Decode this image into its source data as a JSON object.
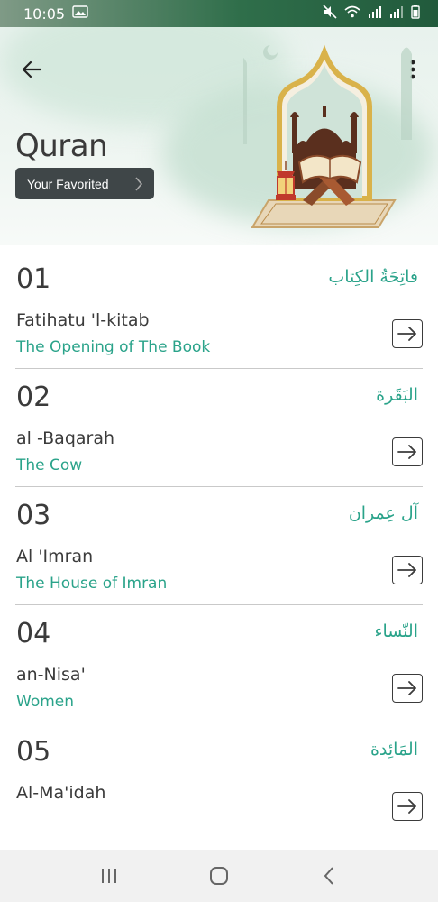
{
  "status_bar": {
    "time": "10:05"
  },
  "header": {
    "title": "Quran",
    "favorite_label": "Your Favorited"
  },
  "surahs": [
    {
      "number": "01",
      "arabic": "فاتِحَةُ الكِتاب",
      "name": "Fatihatu 'l-kitab",
      "meaning": "The Opening of The Book"
    },
    {
      "number": "02",
      "arabic": "البَقَرة",
      "name": "al -Baqarah",
      "meaning": "The Cow"
    },
    {
      "number": "03",
      "arabic": "آل عِمران",
      "name": "Al 'Imran",
      "meaning": "The House of Imran"
    },
    {
      "number": "04",
      "arabic": "النّساء",
      "name": "an-Nisa'",
      "meaning": "Women"
    },
    {
      "number": "05",
      "arabic": "المَائِدة",
      "name": "Al-Ma'idah",
      "meaning": ""
    }
  ],
  "icons": {
    "back": "arrow-left-icon",
    "more": "more-vertical-icon",
    "go": "arrow-right-icon",
    "nav_recents": "recents-icon",
    "nav_home": "home-icon",
    "nav_back": "back-chevron-icon"
  },
  "colors": {
    "accent": "#2aa38a",
    "text_dark": "#3b3b3b",
    "favorite_button": "#3f4648",
    "status_bar": "#2f6e4a"
  }
}
